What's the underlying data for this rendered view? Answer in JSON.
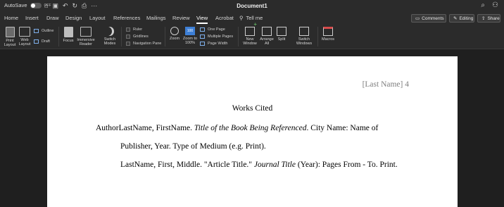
{
  "titlebar": {
    "autosave_label": "AutoSave",
    "autosave_state": "OFF",
    "document_title": "Document1",
    "quick_icons": [
      "home-icon",
      "save-icon",
      "undo-icon",
      "redo-icon",
      "print-icon",
      "more-icon"
    ]
  },
  "menu": {
    "tabs": [
      "Home",
      "Insert",
      "Draw",
      "Design",
      "Layout",
      "References",
      "Mailings",
      "Review",
      "View",
      "Acrobat"
    ],
    "active_tab": "View",
    "tell_me": "Tell me",
    "comments_label": "Comments",
    "editing_label": "Editing",
    "share_label": "Share"
  },
  "ribbon": {
    "print_layout": "Print Layout",
    "web_layout": "Web Layout",
    "outline": "Outline",
    "draft": "Draft",
    "focus": "Focus",
    "immersive_reader": "Immersive Reader",
    "switch_modes": "Switch Modes",
    "ruler": "Ruler",
    "gridlines": "Gridlines",
    "navigation_pane": "Navigation Pane",
    "zoom": "Zoom",
    "zoom_100": "Zoom to 100%",
    "zoom_100_badge": "100",
    "one_page": "One Page",
    "multiple_pages": "Multiple Pages",
    "page_width": "Page Width",
    "new_window": "New Window",
    "arrange_all": "Arrange All",
    "split": "Split",
    "switch_windows": "Switch Windows",
    "macros": "Macros"
  },
  "document": {
    "header": "[Last Name] 4",
    "title": "Works Cited",
    "entry1": {
      "pre": "AuthorLastName, FirstName. ",
      "italic": "Title of the Book Being Referenced",
      "post": ". City Name: Name of",
      "cont": "Publisher, Year. Type of Medium (e.g. Print)."
    },
    "entry2": {
      "pre": "LastName, First, Middle. \"Article Title.\" ",
      "italic": "Journal Title",
      "post": " (Year): Pages From - To. Print."
    }
  }
}
